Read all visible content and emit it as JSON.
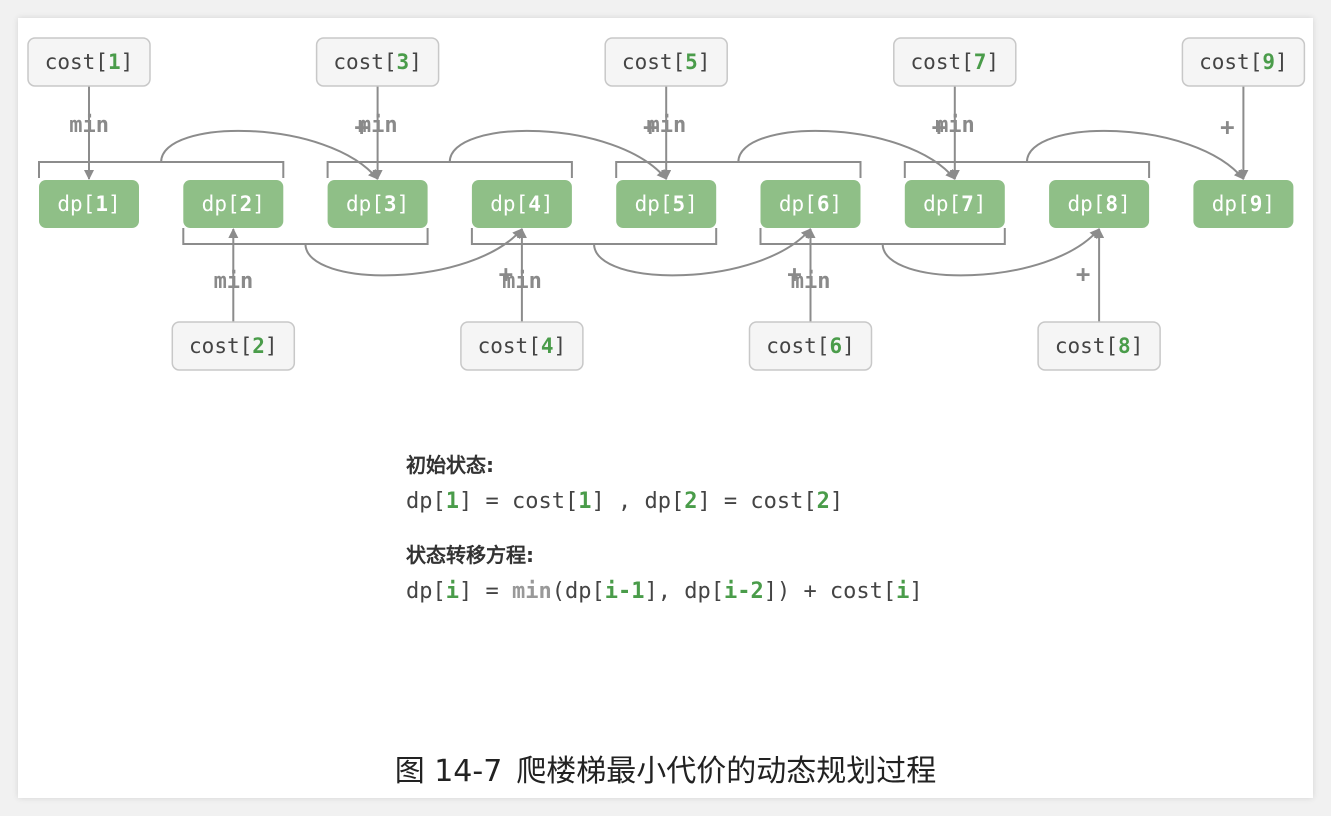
{
  "dp_nodes": [
    {
      "prefix": "dp[",
      "index": "1",
      "suffix": "]"
    },
    {
      "prefix": "dp[",
      "index": "2",
      "suffix": "]"
    },
    {
      "prefix": "dp[",
      "index": "3",
      "suffix": "]"
    },
    {
      "prefix": "dp[",
      "index": "4",
      "suffix": "]"
    },
    {
      "prefix": "dp[",
      "index": "5",
      "suffix": "]"
    },
    {
      "prefix": "dp[",
      "index": "6",
      "suffix": "]"
    },
    {
      "prefix": "dp[",
      "index": "7",
      "suffix": "]"
    },
    {
      "prefix": "dp[",
      "index": "8",
      "suffix": "]"
    },
    {
      "prefix": "dp[",
      "index": "9",
      "suffix": "]"
    }
  ],
  "cost_nodes": [
    {
      "prefix": "cost[",
      "index": "1",
      "suffix": "]"
    },
    {
      "prefix": "cost[",
      "index": "2",
      "suffix": "]"
    },
    {
      "prefix": "cost[",
      "index": "3",
      "suffix": "]"
    },
    {
      "prefix": "cost[",
      "index": "4",
      "suffix": "]"
    },
    {
      "prefix": "cost[",
      "index": "5",
      "suffix": "]"
    },
    {
      "prefix": "cost[",
      "index": "6",
      "suffix": "]"
    },
    {
      "prefix": "cost[",
      "index": "7",
      "suffix": "]"
    },
    {
      "prefix": "cost[",
      "index": "8",
      "suffix": "]"
    },
    {
      "prefix": "cost[",
      "index": "9",
      "suffix": "]"
    }
  ],
  "labels": {
    "min": "min",
    "plus": "+"
  },
  "colors": {
    "dp_fill": "#8fbf87",
    "dp_text": "#ffffff",
    "cost_fill": "#f5f5f5",
    "cost_border": "#c8c8c8",
    "cost_index": "#4a9c4a",
    "line": "#8c8c8c",
    "label": "#8a8a8a"
  },
  "formulas": {
    "initial_heading": "初始状态:",
    "initial": {
      "a": "dp[",
      "b": "1",
      "c": "] = cost[",
      "d": "1",
      "e": "] , dp[",
      "f": "2",
      "g": "] = cost[",
      "h": "2",
      "i": "]"
    },
    "transition_heading": "状态转移方程:",
    "transition": {
      "a": "dp[",
      "b": "i",
      "c": "] = ",
      "d": "min",
      "e": "(dp[",
      "f": "i-1",
      "g": "], dp[",
      "h": "i-2",
      "i": "]",
      "j": ") + cost[",
      "k": "i",
      "l": "]"
    }
  },
  "caption": {
    "number": "图 14-7",
    "title": "爬楼梯最小代价的动态规划过程"
  }
}
